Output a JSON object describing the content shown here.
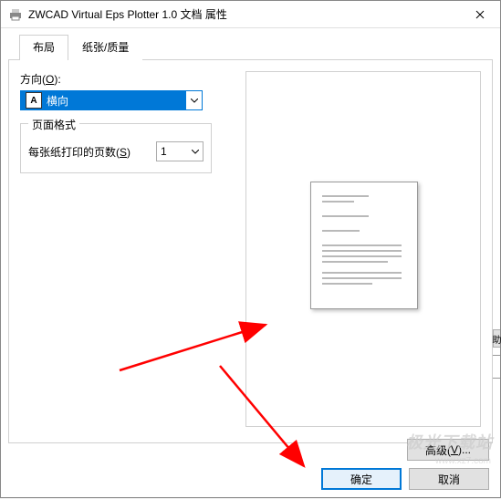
{
  "titlebar": {
    "title": "ZWCAD Virtual Eps Plotter 1.0 文档 属性"
  },
  "tabs": {
    "layout": "布局",
    "paper_quality": "纸张/质量"
  },
  "orientation": {
    "label_prefix": "方向(",
    "label_key": "O",
    "label_suffix": "):",
    "icon_letter": "A",
    "value": "横向"
  },
  "page_format": {
    "legend": "页面格式",
    "pps_label_prefix": "每张纸打印的页数(",
    "pps_label_key": "S",
    "pps_label_suffix": ")",
    "pps_value": "1"
  },
  "buttons": {
    "advanced_prefix": "高级(",
    "advanced_key": "V",
    "advanced_suffix": ")...",
    "ok": "确定",
    "cancel": "取消"
  },
  "watermark": {
    "brand": "极光下载站",
    "url": "www.xz7.com"
  },
  "fragment": {
    "help": "助"
  }
}
